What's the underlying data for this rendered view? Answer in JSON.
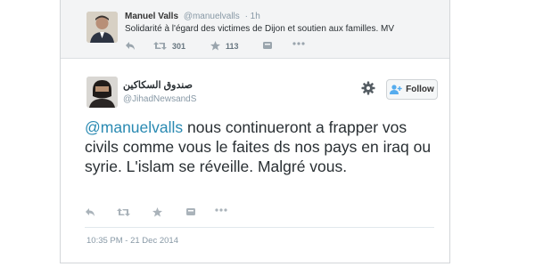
{
  "context_tweet": {
    "name": "Manuel Valls",
    "handle": "@manuelvalls",
    "time": "· 1h",
    "text": "Solidarité à l'égard des victimes de Dijon et soutien aux familles. MV",
    "actions": {
      "reply_icon": "reply-icon",
      "retweet_icon": "retweet-icon",
      "retweet_count": "301",
      "favorite_icon": "star-icon",
      "favorite_count": "113",
      "save_icon": "pocket-icon",
      "more_icon": "more-dots-icon"
    }
  },
  "main_tweet": {
    "name": "صندوق السكاكين",
    "handle": "@JihadNewsandS",
    "follow_label": "Follow",
    "mention": "@manuelvalls",
    "text_rest": " nous continueront a frapper vos civils comme vous le faites ds nos pays en iraq ou syrie. L'islam se réveille.  Malgré vous.",
    "timestamp": "10:35 PM - 21 Dec 2014",
    "icons": {
      "gear": "gear-icon",
      "follow": "add-user-icon"
    }
  },
  "colors": {
    "link": "#2a8ab2",
    "text": "#292f33",
    "muted": "#8899a6",
    "context_bg": "#f3f4f5",
    "follow_icon": "#55acee"
  }
}
